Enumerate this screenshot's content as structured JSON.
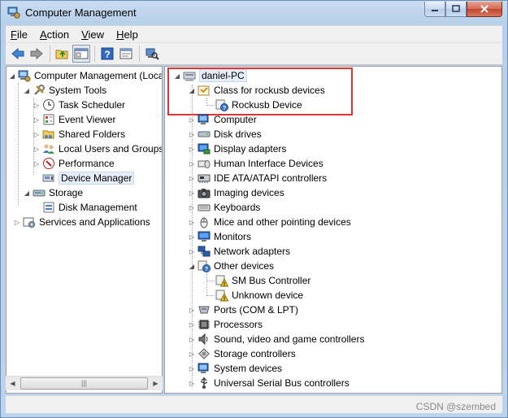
{
  "window": {
    "title": "Computer Management"
  },
  "menu": [
    {
      "label": "File",
      "accel": "F"
    },
    {
      "label": "Action",
      "accel": "A"
    },
    {
      "label": "View",
      "accel": "V"
    },
    {
      "label": "Help",
      "accel": "H"
    }
  ],
  "toolbar": {
    "icons": [
      "back-arrow-icon",
      "forward-arrow-icon",
      "up-folder-icon",
      "show-hide-tree-icon",
      "help-icon",
      "properties-icon",
      "scan-hardware-icon"
    ]
  },
  "left_tree": {
    "root": "Computer Management (Local",
    "system_tools": "System Tools",
    "task_scheduler": "Task Scheduler",
    "event_viewer": "Event Viewer",
    "shared_folders": "Shared Folders",
    "local_users": "Local Users and Groups",
    "performance": "Performance",
    "device_manager": "Device Manager",
    "storage": "Storage",
    "disk_management": "Disk Management",
    "services": "Services and Applications"
  },
  "device_tree": {
    "root": "daniel-PC",
    "class_rockusb": "Class for rockusb devices",
    "rockusb_device": "Rockusb Device",
    "computer": "Computer",
    "disk_drives": "Disk drives",
    "display_adapters": "Display adapters",
    "hid": "Human Interface Devices",
    "ide": "IDE ATA/ATAPI controllers",
    "imaging": "Imaging devices",
    "keyboards": "Keyboards",
    "mice": "Mice and other pointing devices",
    "monitors": "Monitors",
    "network": "Network adapters",
    "other": "Other devices",
    "sm_bus": "SM Bus Controller",
    "unknown": "Unknown device",
    "ports": "Ports (COM & LPT)",
    "processors": "Processors",
    "sound": "Sound, video and game controllers",
    "storage_ctrl": "Storage controllers",
    "system_devices": "System devices",
    "usb": "Universal Serial Bus controllers"
  },
  "watermark": "CSDN @szembed",
  "colors": {
    "highlight_box": "#e03434",
    "selection": "#e5eef8"
  }
}
